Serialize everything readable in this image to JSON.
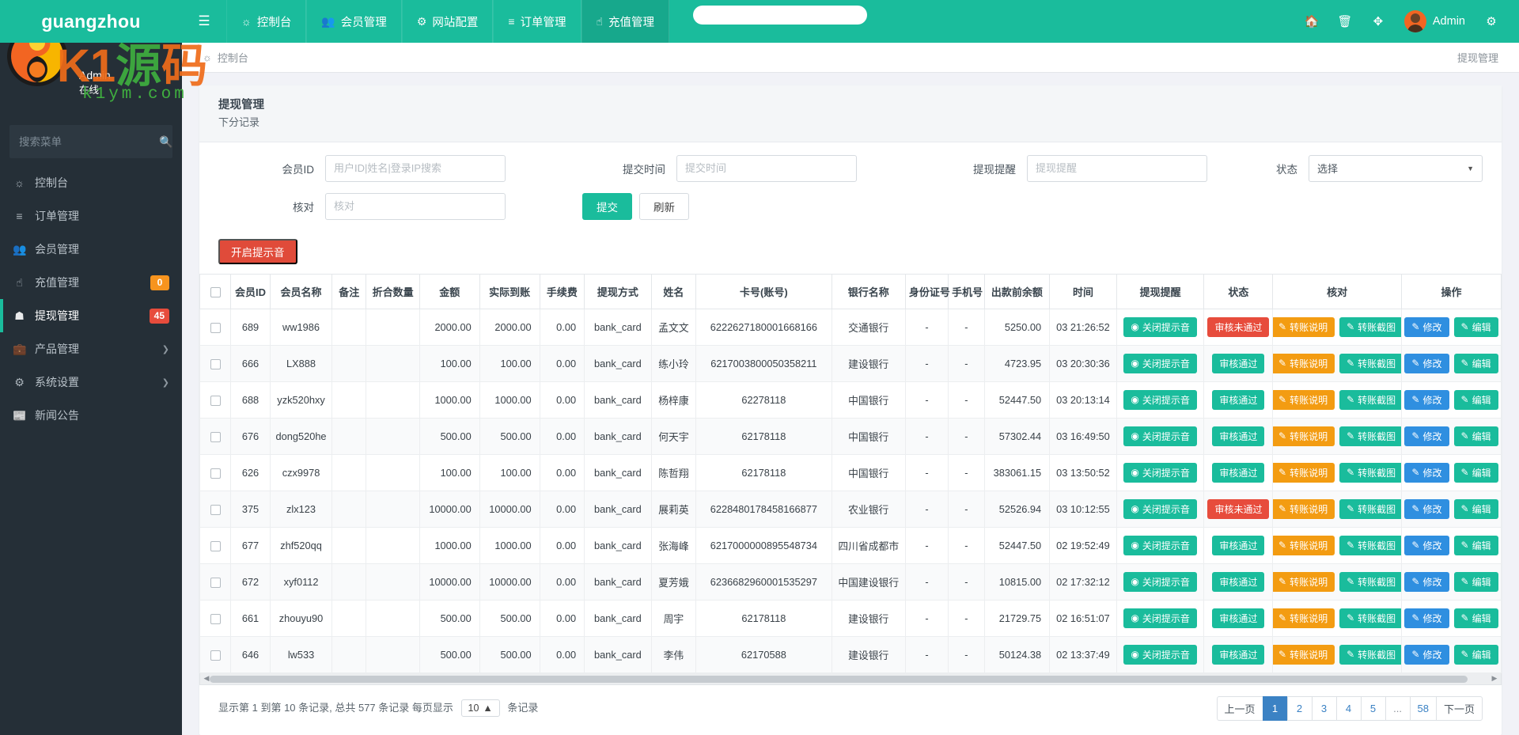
{
  "brand": {
    "name": "guangzhou",
    "watermark": "K1源码",
    "watermark_url": "k1ym.com"
  },
  "topnav": {
    "menu_icon": "hamburger-icon",
    "items": [
      {
        "label": "控制台",
        "icon": "dashboard-icon"
      },
      {
        "label": "会员管理",
        "icon": "users-icon"
      },
      {
        "label": "网站配置",
        "icon": "gear-icon"
      },
      {
        "label": "订单管理",
        "icon": "list-icon"
      },
      {
        "label": "充值管理",
        "icon": "hand-icon"
      }
    ],
    "right_icons": [
      {
        "name": "home-icon",
        "glyph": "⌂"
      },
      {
        "name": "trash-icon",
        "glyph": "🗑"
      },
      {
        "name": "fullscreen-icon",
        "glyph": "✖"
      }
    ],
    "user": "Admin",
    "settings_icon": "gears-icon"
  },
  "sidebar": {
    "user_name": "Admin",
    "user_status": "在线",
    "search_placeholder": "搜索菜单",
    "search_value": "",
    "items": [
      {
        "label": "控制台",
        "icon": "dashboard-icon",
        "badge": null,
        "badge_color": null,
        "active": false,
        "caret": false
      },
      {
        "label": "订单管理",
        "icon": "list-icon",
        "badge": null,
        "badge_color": null,
        "active": false,
        "caret": false
      },
      {
        "label": "会员管理",
        "icon": "users-icon",
        "badge": null,
        "badge_color": null,
        "active": false,
        "caret": false
      },
      {
        "label": "充值管理",
        "icon": "hand-icon",
        "badge": "0",
        "badge_color": "#f7941e",
        "active": false,
        "caret": false
      },
      {
        "label": "提现管理",
        "icon": "withdraw-icon",
        "badge": "45",
        "badge_color": "#e74c3c",
        "active": true,
        "caret": false
      },
      {
        "label": "产品管理",
        "icon": "bag-icon",
        "badge": null,
        "badge_color": null,
        "active": false,
        "caret": true
      },
      {
        "label": "系统设置",
        "icon": "cogs-icon",
        "badge": null,
        "badge_color": null,
        "active": false,
        "caret": true
      },
      {
        "label": "新闻公告",
        "icon": "news-icon",
        "badge": null,
        "badge_color": null,
        "active": false,
        "caret": false
      }
    ]
  },
  "breadcrumb": {
    "icon": "dashboard-icon",
    "text": "控制台",
    "right": "提现管理"
  },
  "panel": {
    "title": "提现管理",
    "subtitle": "下分记录"
  },
  "filters": {
    "member_id": {
      "label": "会员ID",
      "placeholder": "用户ID|姓名|登录IP搜索",
      "value": ""
    },
    "submit_time": {
      "label": "提交时间",
      "placeholder": "提交时间",
      "value": ""
    },
    "withdraw_note": {
      "label": "提现提醒",
      "placeholder": "提现提醒",
      "value": ""
    },
    "status": {
      "label": "状态",
      "value": "选择",
      "options": [
        "选择"
      ]
    },
    "check": {
      "label": "核对",
      "placeholder": "核对",
      "value": ""
    },
    "submit_button": "提交",
    "refresh_button": "刷新"
  },
  "toolbar": {
    "sound_button": "开启提示音"
  },
  "table": {
    "columns": [
      "",
      "会员ID",
      "会员名称",
      "备注",
      "折合数量",
      "金额",
      "实际到账",
      "手续费",
      "提现方式",
      "姓名",
      "卡号(账号)",
      "银行名称",
      "身份证号",
      "手机号",
      "出款前余额",
      "时间",
      "提现提醒",
      "状态",
      "核对",
      "操作"
    ],
    "rows": [
      {
        "id": "689",
        "name": "ww1986",
        "note": "",
        "qty": "",
        "amount": "2000.00",
        "actual": "2000.00",
        "fee": "0.00",
        "method": "bank_card",
        "person": "孟文文",
        "card": "6222627180001668166",
        "bank": "交通银行",
        "idcard": "-",
        "phone": "-",
        "balance": "5250.00",
        "time": "03 21:26:52",
        "remind": "关闭提示音",
        "status": "审核未通过",
        "status_color": "red",
        "check1": "转账说明",
        "check2": "转账截图",
        "op1": "修改",
        "op2": "编辑"
      },
      {
        "id": "666",
        "name": "LX888",
        "note": "",
        "qty": "",
        "amount": "100.00",
        "actual": "100.00",
        "fee": "0.00",
        "method": "bank_card",
        "person": "练小玲",
        "card": "6217003800050358211",
        "bank": "建设银行",
        "idcard": "-",
        "phone": "-",
        "balance": "4723.95",
        "time": "03 20:30:36",
        "remind": "关闭提示音",
        "status": "审核通过",
        "status_color": "green",
        "check1": "转账说明",
        "check2": "转账截图",
        "op1": "修改",
        "op2": "编辑"
      },
      {
        "id": "688",
        "name": "yzk520hxy",
        "note": "",
        "qty": "",
        "amount": "1000.00",
        "actual": "1000.00",
        "fee": "0.00",
        "method": "bank_card",
        "person": "杨梓康",
        "card": "62278118",
        "bank": "中国银行",
        "idcard": "-",
        "phone": "-",
        "balance": "52447.50",
        "time": "03 20:13:14",
        "remind": "关闭提示音",
        "status": "审核通过",
        "status_color": "green",
        "check1": "转账说明",
        "check2": "转账截图",
        "op1": "修改",
        "op2": "编辑"
      },
      {
        "id": "676",
        "name": "dong520he",
        "note": "",
        "qty": "",
        "amount": "500.00",
        "actual": "500.00",
        "fee": "0.00",
        "method": "bank_card",
        "person": "何天宇",
        "card": "62178118",
        "bank": "中国银行",
        "idcard": "-",
        "phone": "-",
        "balance": "57302.44",
        "time": "03 16:49:50",
        "remind": "关闭提示音",
        "status": "审核通过",
        "status_color": "green",
        "check1": "转账说明",
        "check2": "转账截图",
        "op1": "修改",
        "op2": "编辑"
      },
      {
        "id": "626",
        "name": "czx9978",
        "note": "",
        "qty": "",
        "amount": "100.00",
        "actual": "100.00",
        "fee": "0.00",
        "method": "bank_card",
        "person": "陈哲翔",
        "card": "62178118",
        "bank": "中国银行",
        "idcard": "-",
        "phone": "-",
        "balance": "383061.15",
        "time": "03 13:50:52",
        "remind": "关闭提示音",
        "status": "审核通过",
        "status_color": "green",
        "check1": "转账说明",
        "check2": "转账截图",
        "op1": "修改",
        "op2": "编辑"
      },
      {
        "id": "375",
        "name": "zlx123",
        "note": "",
        "qty": "",
        "amount": "10000.00",
        "actual": "10000.00",
        "fee": "0.00",
        "method": "bank_card",
        "person": "展莉英",
        "card": "6228480178458166877",
        "bank": "农业银行",
        "idcard": "-",
        "phone": "-",
        "balance": "52526.94",
        "time": "03 10:12:55",
        "remind": "关闭提示音",
        "status": "审核未通过",
        "status_color": "red",
        "check1": "转账说明",
        "check2": "转账截图",
        "op1": "修改",
        "op2": "编辑"
      },
      {
        "id": "677",
        "name": "zhf520qq",
        "note": "",
        "qty": "",
        "amount": "1000.00",
        "actual": "1000.00",
        "fee": "0.00",
        "method": "bank_card",
        "person": "张海峰",
        "card": "6217000000895548734",
        "bank": "四川省成都市",
        "idcard": "-",
        "phone": "-",
        "balance": "52447.50",
        "time": "02 19:52:49",
        "remind": "关闭提示音",
        "status": "审核通过",
        "status_color": "green",
        "check1": "转账说明",
        "check2": "转账截图",
        "op1": "修改",
        "op2": "编辑"
      },
      {
        "id": "672",
        "name": "xyf0112",
        "note": "",
        "qty": "",
        "amount": "10000.00",
        "actual": "10000.00",
        "fee": "0.00",
        "method": "bank_card",
        "person": "夏芳娥",
        "card": "6236682960001535297",
        "bank": "中国建设银行",
        "idcard": "-",
        "phone": "-",
        "balance": "10815.00",
        "time": "02 17:32:12",
        "remind": "关闭提示音",
        "status": "审核通过",
        "status_color": "green",
        "check1": "转账说明",
        "check2": "转账截图",
        "op1": "修改",
        "op2": "编辑"
      },
      {
        "id": "661",
        "name": "zhouyu90",
        "note": "",
        "qty": "",
        "amount": "500.00",
        "actual": "500.00",
        "fee": "0.00",
        "method": "bank_card",
        "person": "周宇",
        "card": "62178118",
        "bank": "建设银行",
        "idcard": "-",
        "phone": "-",
        "balance": "21729.75",
        "time": "02 16:51:07",
        "remind": "关闭提示音",
        "status": "审核通过",
        "status_color": "green",
        "check1": "转账说明",
        "check2": "转账截图",
        "op1": "修改",
        "op2": "编辑"
      },
      {
        "id": "646",
        "name": "lw533",
        "note": "",
        "qty": "",
        "amount": "500.00",
        "actual": "500.00",
        "fee": "0.00",
        "method": "bank_card",
        "person": "李伟",
        "card": "62170588",
        "bank": "建设银行",
        "idcard": "-",
        "phone": "-",
        "balance": "50124.38",
        "time": "02 13:37:49",
        "remind": "关闭提示音",
        "status": "审核通过",
        "status_color": "green",
        "check1": "转账说明",
        "check2": "转账截图",
        "op1": "修改",
        "op2": "编辑"
      }
    ]
  },
  "footer": {
    "info_prefix": "显示第 1 到第 10 条记录, 总共 577 条记录 每页显示",
    "page_size": "10",
    "info_suffix": "条记录",
    "pager": [
      "上一页",
      "1",
      "2",
      "3",
      "4",
      "5",
      "...",
      "58",
      "下一页"
    ],
    "active_page": "1"
  }
}
